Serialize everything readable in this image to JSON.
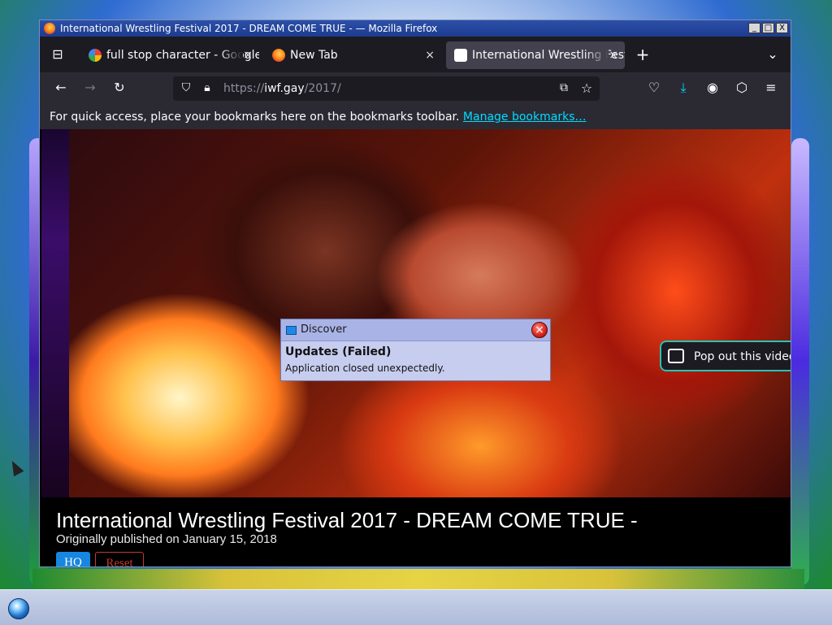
{
  "window": {
    "title": "International Wrestling Festival 2017 - DREAM COME TRUE - — Mozilla Firefox",
    "minimize": "_",
    "maximize": "□",
    "close": "X"
  },
  "tabs": [
    {
      "label": "full stop character - Google",
      "close": "×",
      "favicon": "google-favicon"
    },
    {
      "label": "New Tab",
      "close": "×",
      "favicon": "firefox-favicon"
    },
    {
      "label": "International Wrestling Festival",
      "close": "×",
      "favicon": "site-favicon",
      "active": true
    }
  ],
  "toolbar": {
    "new_tab": "+",
    "url_scheme": "https://",
    "url_host": "iwf.gay",
    "url_path": "/2017/"
  },
  "bookmarks_bar": {
    "message": "For quick access, place your bookmarks here on the bookmarks toolbar.",
    "link": "Manage bookmarks…"
  },
  "video": {
    "pip_label": "Pop out this video",
    "title": "International Wrestling Festival 2017 - DREAM COME TRUE -",
    "subtitle": "Originally published on January 15, 2018",
    "hq_label": "HQ",
    "reset_label": "Reset"
  },
  "notification": {
    "app": "Discover",
    "close": "×",
    "title": "Updates (Failed)",
    "body": "Application closed unexpectedly."
  },
  "colors": {
    "accent": "#00ddff",
    "titlebar": "#2c4fa8",
    "pip_border": "#27c4b4",
    "hq": "#1686e0",
    "reset": "#c0392b"
  }
}
